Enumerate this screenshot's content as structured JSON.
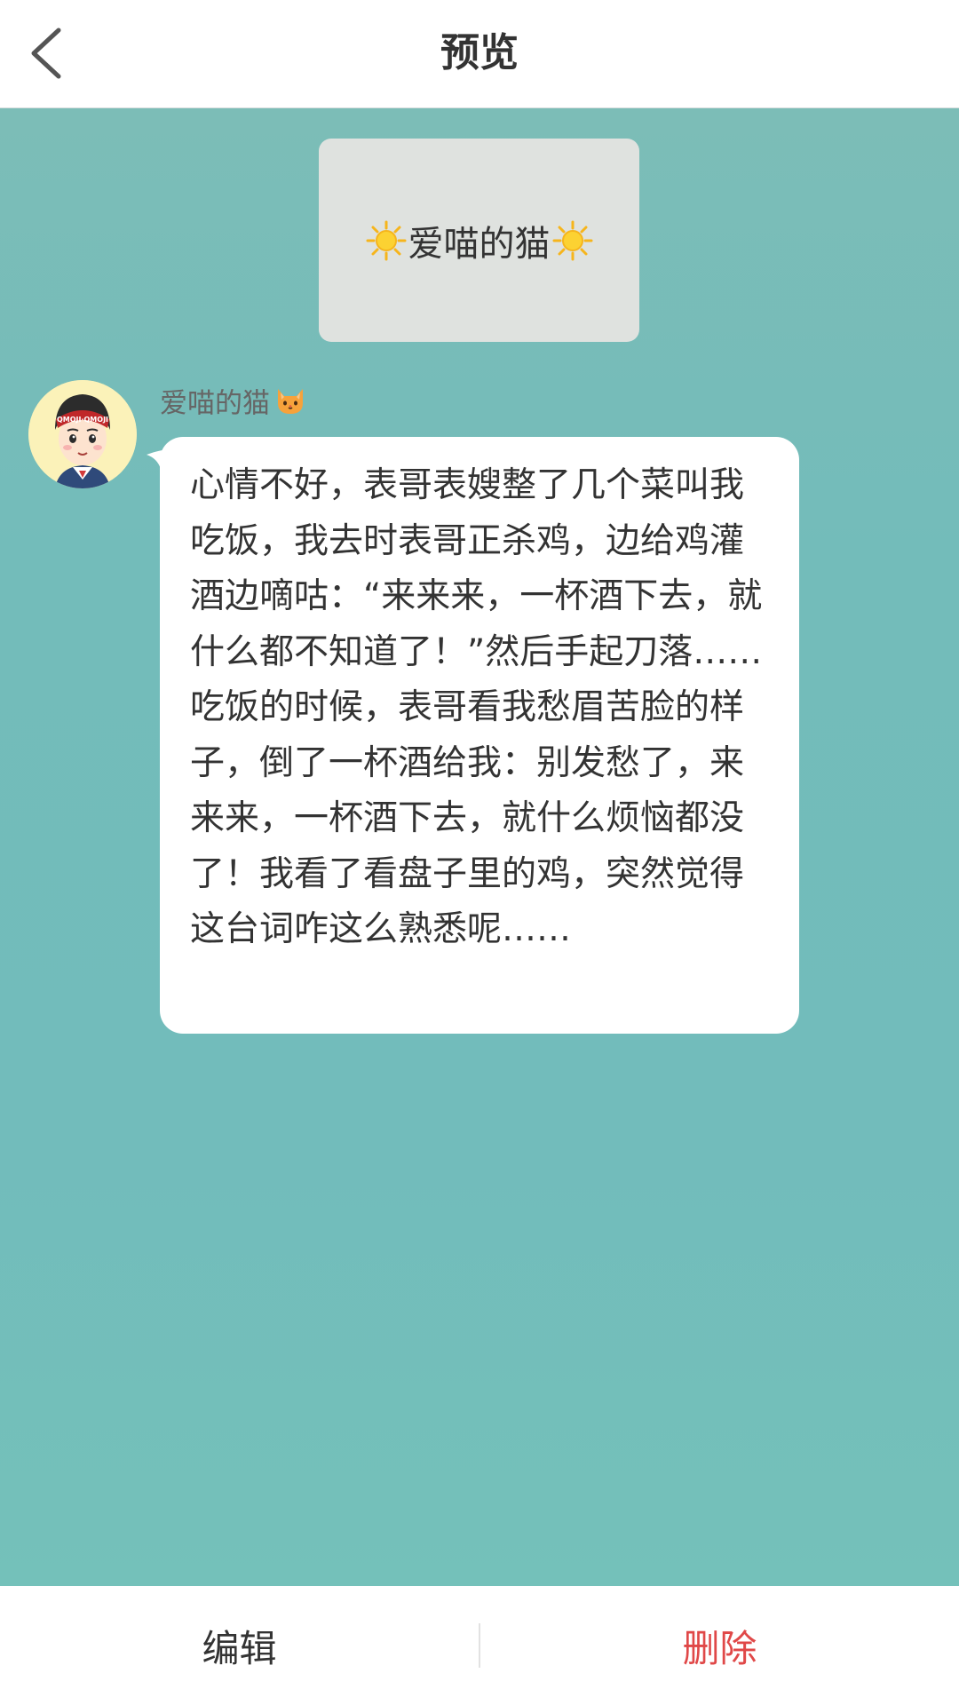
{
  "header": {
    "title": "预览",
    "back_icon": "back-arrow-icon"
  },
  "card": {
    "text": "爱喵的猫",
    "icon": "sun-emoji-icon"
  },
  "message": {
    "sender_name": "爱喵的猫",
    "sender_emoji": "cat-face-icon",
    "avatar_text": "QMOJI·QMOJI",
    "text": "心情不好，表哥表嫂整了几个菜叫我吃饭，我去时表哥正杀鸡，边给鸡灌酒边嘀咕：“来来来，一杯酒下去，就什么都不知道了！”然后手起刀落…… 吃饭的时候，表哥看我愁眉苦脸的样子，倒了一杯酒给我：别发愁了，来来来，一杯酒下去，就什么烦恼都没了！我看了看盘子里的鸡，突然觉得这台词咋这么熟悉呢……"
  },
  "footer": {
    "edit_label": "编辑",
    "delete_label": "删除"
  },
  "colors": {
    "background": "#76bdb9",
    "delete": "#e04848",
    "text": "#333333"
  }
}
